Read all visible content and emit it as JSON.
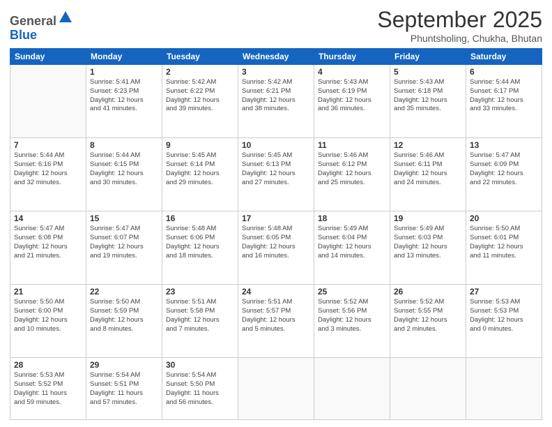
{
  "logo": {
    "general": "General",
    "blue": "Blue"
  },
  "header": {
    "month": "September 2025",
    "location": "Phuntsholing, Chukha, Bhutan"
  },
  "weekdays": [
    "Sunday",
    "Monday",
    "Tuesday",
    "Wednesday",
    "Thursday",
    "Friday",
    "Saturday"
  ],
  "weeks": [
    [
      {
        "day": "",
        "info": ""
      },
      {
        "day": "1",
        "info": "Sunrise: 5:41 AM\nSunset: 6:23 PM\nDaylight: 12 hours\nand 41 minutes."
      },
      {
        "day": "2",
        "info": "Sunrise: 5:42 AM\nSunset: 6:22 PM\nDaylight: 12 hours\nand 39 minutes."
      },
      {
        "day": "3",
        "info": "Sunrise: 5:42 AM\nSunset: 6:21 PM\nDaylight: 12 hours\nand 38 minutes."
      },
      {
        "day": "4",
        "info": "Sunrise: 5:43 AM\nSunset: 6:19 PM\nDaylight: 12 hours\nand 36 minutes."
      },
      {
        "day": "5",
        "info": "Sunrise: 5:43 AM\nSunset: 6:18 PM\nDaylight: 12 hours\nand 35 minutes."
      },
      {
        "day": "6",
        "info": "Sunrise: 5:44 AM\nSunset: 6:17 PM\nDaylight: 12 hours\nand 33 minutes."
      }
    ],
    [
      {
        "day": "7",
        "info": "Sunrise: 5:44 AM\nSunset: 6:16 PM\nDaylight: 12 hours\nand 32 minutes."
      },
      {
        "day": "8",
        "info": "Sunrise: 5:44 AM\nSunset: 6:15 PM\nDaylight: 12 hours\nand 30 minutes."
      },
      {
        "day": "9",
        "info": "Sunrise: 5:45 AM\nSunset: 6:14 PM\nDaylight: 12 hours\nand 29 minutes."
      },
      {
        "day": "10",
        "info": "Sunrise: 5:45 AM\nSunset: 6:13 PM\nDaylight: 12 hours\nand 27 minutes."
      },
      {
        "day": "11",
        "info": "Sunrise: 5:46 AM\nSunset: 6:12 PM\nDaylight: 12 hours\nand 25 minutes."
      },
      {
        "day": "12",
        "info": "Sunrise: 5:46 AM\nSunset: 6:11 PM\nDaylight: 12 hours\nand 24 minutes."
      },
      {
        "day": "13",
        "info": "Sunrise: 5:47 AM\nSunset: 6:09 PM\nDaylight: 12 hours\nand 22 minutes."
      }
    ],
    [
      {
        "day": "14",
        "info": "Sunrise: 5:47 AM\nSunset: 6:08 PM\nDaylight: 12 hours\nand 21 minutes."
      },
      {
        "day": "15",
        "info": "Sunrise: 5:47 AM\nSunset: 6:07 PM\nDaylight: 12 hours\nand 19 minutes."
      },
      {
        "day": "16",
        "info": "Sunrise: 5:48 AM\nSunset: 6:06 PM\nDaylight: 12 hours\nand 18 minutes."
      },
      {
        "day": "17",
        "info": "Sunrise: 5:48 AM\nSunset: 6:05 PM\nDaylight: 12 hours\nand 16 minutes."
      },
      {
        "day": "18",
        "info": "Sunrise: 5:49 AM\nSunset: 6:04 PM\nDaylight: 12 hours\nand 14 minutes."
      },
      {
        "day": "19",
        "info": "Sunrise: 5:49 AM\nSunset: 6:03 PM\nDaylight: 12 hours\nand 13 minutes."
      },
      {
        "day": "20",
        "info": "Sunrise: 5:50 AM\nSunset: 6:01 PM\nDaylight: 12 hours\nand 11 minutes."
      }
    ],
    [
      {
        "day": "21",
        "info": "Sunrise: 5:50 AM\nSunset: 6:00 PM\nDaylight: 12 hours\nand 10 minutes."
      },
      {
        "day": "22",
        "info": "Sunrise: 5:50 AM\nSunset: 5:59 PM\nDaylight: 12 hours\nand 8 minutes."
      },
      {
        "day": "23",
        "info": "Sunrise: 5:51 AM\nSunset: 5:58 PM\nDaylight: 12 hours\nand 7 minutes."
      },
      {
        "day": "24",
        "info": "Sunrise: 5:51 AM\nSunset: 5:57 PM\nDaylight: 12 hours\nand 5 minutes."
      },
      {
        "day": "25",
        "info": "Sunrise: 5:52 AM\nSunset: 5:56 PM\nDaylight: 12 hours\nand 3 minutes."
      },
      {
        "day": "26",
        "info": "Sunrise: 5:52 AM\nSunset: 5:55 PM\nDaylight: 12 hours\nand 2 minutes."
      },
      {
        "day": "27",
        "info": "Sunrise: 5:53 AM\nSunset: 5:53 PM\nDaylight: 12 hours\nand 0 minutes."
      }
    ],
    [
      {
        "day": "28",
        "info": "Sunrise: 5:53 AM\nSunset: 5:52 PM\nDaylight: 11 hours\nand 59 minutes."
      },
      {
        "day": "29",
        "info": "Sunrise: 5:54 AM\nSunset: 5:51 PM\nDaylight: 11 hours\nand 57 minutes."
      },
      {
        "day": "30",
        "info": "Sunrise: 5:54 AM\nSunset: 5:50 PM\nDaylight: 11 hours\nand 56 minutes."
      },
      {
        "day": "",
        "info": ""
      },
      {
        "day": "",
        "info": ""
      },
      {
        "day": "",
        "info": ""
      },
      {
        "day": "",
        "info": ""
      }
    ]
  ]
}
